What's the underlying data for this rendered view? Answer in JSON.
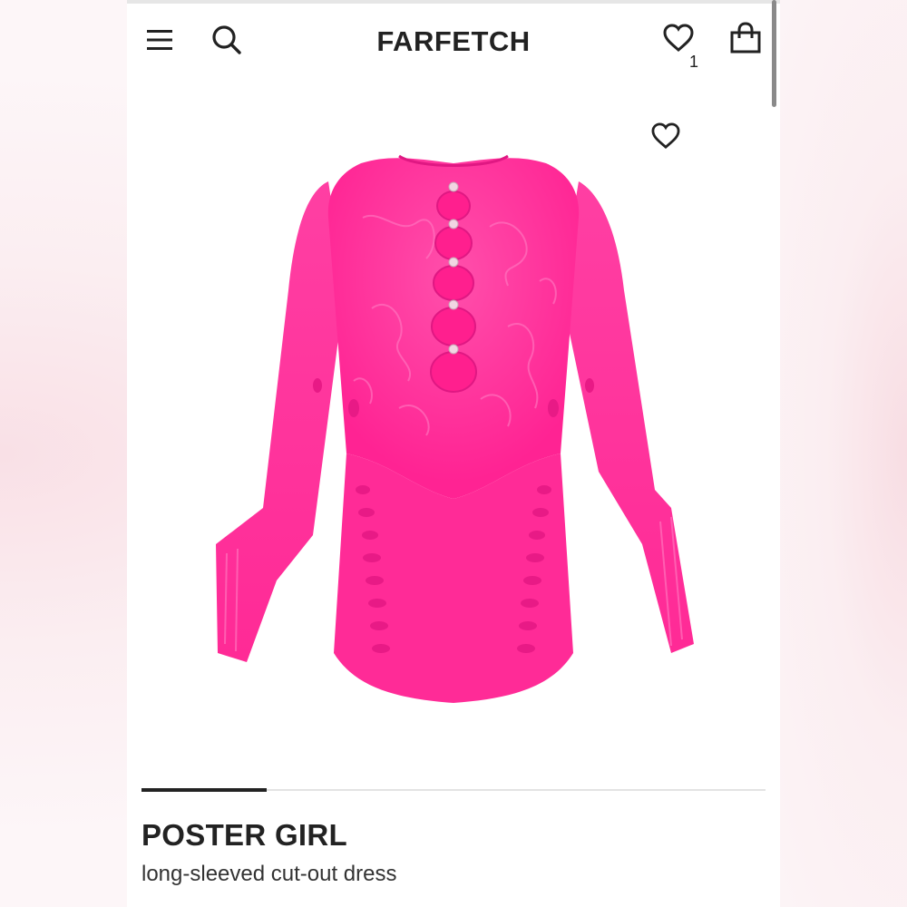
{
  "header": {
    "brand": "FARFETCH",
    "menu_icon": "hamburger-menu-icon",
    "search_icon": "search-icon",
    "wishlist_icon": "heart-icon",
    "wishlist_count": "1",
    "bag_icon": "shopping-bag-icon"
  },
  "product": {
    "designer": "POSTER GIRL",
    "description": "long-sleeved cut-out dress",
    "image_favorite_icon": "heart-outline-icon",
    "gallery_progress": 0.2,
    "colors": {
      "dress_pink": "#ff2f9a",
      "text_dark": "#222222"
    }
  }
}
